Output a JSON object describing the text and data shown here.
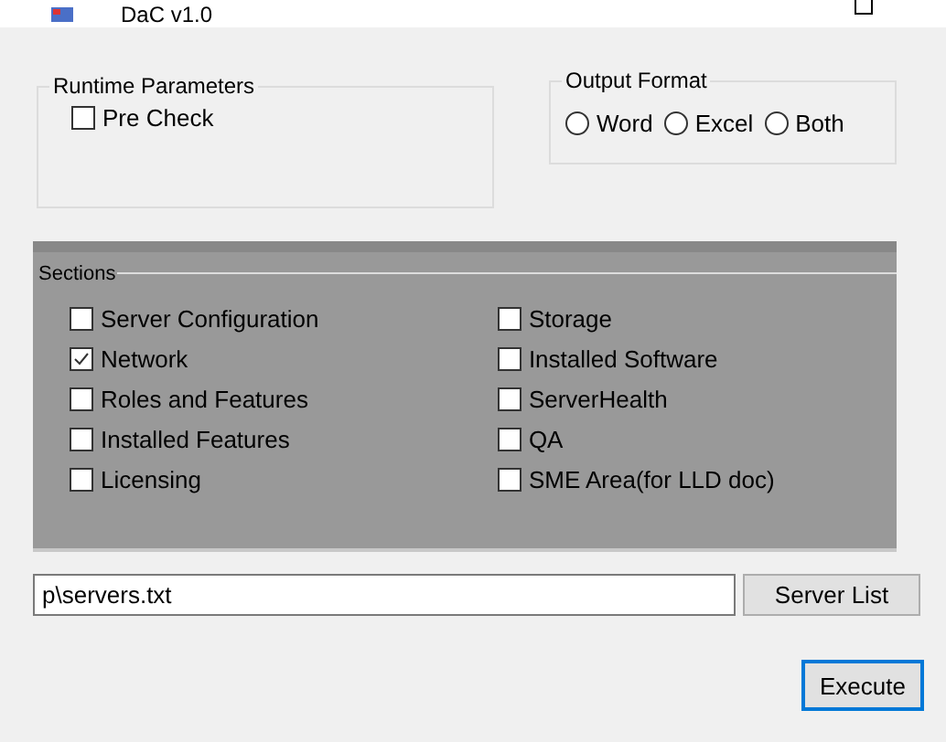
{
  "window": {
    "title": "DaC v1.0"
  },
  "runtime_parameters": {
    "title": "Runtime Parameters",
    "options": [
      {
        "label": "Pre Check",
        "checked": false
      }
    ]
  },
  "output_format": {
    "title": "Output Format",
    "options": [
      {
        "label": "Word",
        "selected": false
      },
      {
        "label": "Excel",
        "selected": false
      },
      {
        "label": "Both",
        "selected": false
      }
    ]
  },
  "sections": {
    "title": "Sections",
    "columns": [
      [
        {
          "label": "Server Configuration",
          "checked": false
        },
        {
          "label": "Network",
          "checked": true
        },
        {
          "label": "Roles and Features",
          "checked": false
        },
        {
          "label": "Installed Features",
          "checked": false
        },
        {
          "label": "Licensing",
          "checked": false
        }
      ],
      [
        {
          "label": "Storage",
          "checked": false
        },
        {
          "label": "Installed Software",
          "checked": false
        },
        {
          "label": "ServerHealth",
          "checked": false
        },
        {
          "label": "QA",
          "checked": false
        },
        {
          "label": "SME Area(for LLD doc)",
          "checked": false
        }
      ]
    ]
  },
  "server_file": {
    "value": "p\\servers.txt",
    "button": "Server List"
  },
  "execute_button": "Execute"
}
